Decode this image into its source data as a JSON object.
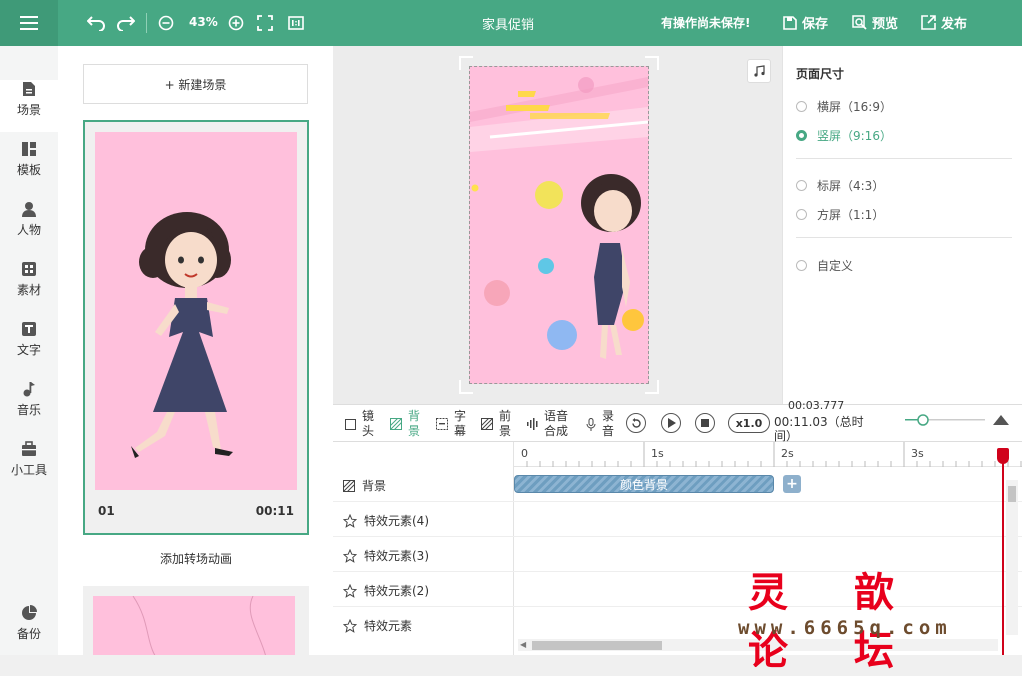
{
  "topbar": {
    "zoom": "43%",
    "title": "家具促销",
    "unsaved": "有操作尚未保存!",
    "save": "保存",
    "preview": "预览",
    "publish": "发布"
  },
  "sidebar": {
    "items": [
      {
        "label": "场景",
        "icon": "scene-icon"
      },
      {
        "label": "模板",
        "icon": "template-icon"
      },
      {
        "label": "人物",
        "icon": "person-icon"
      },
      {
        "label": "素材",
        "icon": "material-icon"
      },
      {
        "label": "文字",
        "icon": "text-icon"
      },
      {
        "label": "音乐",
        "icon": "music-icon"
      },
      {
        "label": "小工具",
        "icon": "toolbox-icon"
      }
    ],
    "backup": "备份"
  },
  "scenes": {
    "new_scene": "+ 新建场景",
    "card": {
      "number": "01",
      "duration": "00:11"
    },
    "add_transition": "添加转场动画"
  },
  "page_size": {
    "heading": "页面尺寸",
    "options": [
      "横屏（16:9）",
      "竖屏（9:16）",
      "标屏（4:3）",
      "方屏（1:1）",
      "自定义"
    ],
    "selected": "竖屏（9:16）"
  },
  "toolbar": {
    "tools": [
      "镜头",
      "背景",
      "字幕",
      "前景",
      "语音合成",
      "录音"
    ],
    "active": "背景",
    "speed": "x1.0",
    "current_time": "00:03.777",
    "total_time": "00:11.03（总时间）"
  },
  "timeline": {
    "ticks": [
      "0",
      "1s",
      "2s",
      "3s"
    ],
    "rows": [
      "背景",
      "特效元素(4)",
      "特效元素(3)",
      "特效元素(2)",
      "特效元素"
    ],
    "bg_bar_label": "颜色背景"
  },
  "watermark": {
    "text": "灵 歆 论 坛",
    "url": "www.6665q.com"
  },
  "colors": {
    "accent": "#47a884",
    "stage_bg": "#ffc0dc",
    "playhead": "#d0021b"
  }
}
